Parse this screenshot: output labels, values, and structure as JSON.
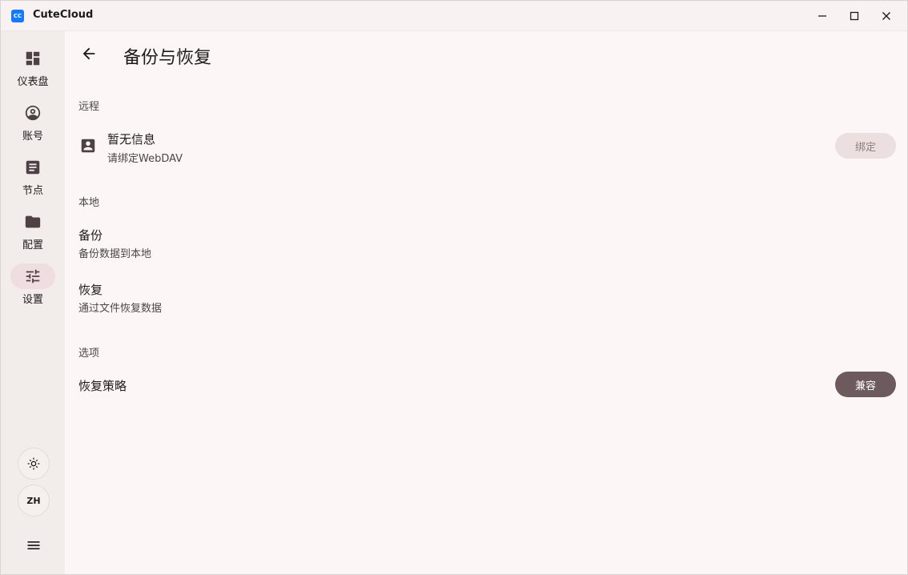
{
  "app": {
    "title": "CuteCloud",
    "logo_text": "CC"
  },
  "window_controls": {
    "minimize": "minimize-icon",
    "maximize": "maximize-icon",
    "close": "close-icon"
  },
  "sidebar": {
    "items": [
      {
        "label": "仪表盘",
        "icon": "dashboard-icon"
      },
      {
        "label": "账号",
        "icon": "account-icon"
      },
      {
        "label": "节点",
        "icon": "nodes-icon"
      },
      {
        "label": "配置",
        "icon": "folder-icon"
      },
      {
        "label": "设置",
        "icon": "settings-tune-icon",
        "active": true
      }
    ],
    "theme_icon": "brightness-icon",
    "language": "ZH",
    "menu_icon": "menu-icon"
  },
  "page": {
    "title": "备份与恢复",
    "remote": {
      "section": "远程",
      "title": "暂无信息",
      "subtitle": "请绑定WebDAV",
      "button": "绑定"
    },
    "local": {
      "section": "本地",
      "backup_title": "备份",
      "backup_subtitle": "备份数据到本地",
      "restore_title": "恢复",
      "restore_subtitle": "通过文件恢复数据"
    },
    "options": {
      "section": "选项",
      "strategy_title": "恢复策略",
      "strategy_value": "兼容"
    }
  },
  "colors": {
    "accent": "#6d5a5d",
    "active_indicator": "#f0dde0",
    "background": "#fcf7f6",
    "sidebar": "#f2eceb"
  }
}
